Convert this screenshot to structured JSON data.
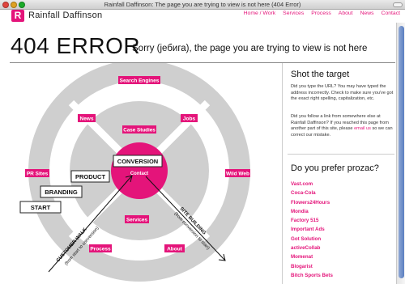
{
  "window": {
    "title": "Rainfall Daffinson: The page you are trying to view is not here (404 Error)"
  },
  "brand": {
    "logo_letter": "R",
    "name": "Rainfall Daffinson",
    "brand_color": "#e4147a"
  },
  "nav": [
    "Home / Work",
    "Services",
    "Process",
    "About",
    "News",
    "Contact"
  ],
  "error": {
    "title": "404 ERROR",
    "subtitle": "Sorry (јебига), the page you are trying to view is not here"
  },
  "diagram": {
    "ring_labels": {
      "search_engines": "Search Engines",
      "news": "News",
      "jobs": "Jobs",
      "pr_sites": "PR Sites",
      "wild_web": "Wild Web",
      "process": "Process",
      "about": "About"
    },
    "inner_labels": {
      "case_studies": "Case Studies",
      "services": "Services",
      "contact": "Contact"
    },
    "conversion": "CONVERSION",
    "steps": {
      "product": "PRODUCT",
      "branding": "BRANDING",
      "start": "START"
    },
    "arrows": {
      "customer_walk": "CUSTOMER WALK",
      "customer_walk_sub": "(from start to conversion)",
      "site_building": "SITE BUILDING",
      "site_building_sub": "(from conversion to start)"
    }
  },
  "sidebar": {
    "target_heading": "Shot the target",
    "target_p1": "Did you type the URL? You may have typed the address incorrectly. Check to make sure you've got the exact right spelling, capitalization, etc.",
    "target_p2_pre": "Did you follow a link from somewhere else at Rainfall Daffinson? If you reached this page from another part of this site, please",
    "target_p2_link": "email us",
    "target_p2_post": "so we can correct our mistake.",
    "prozac_heading": "Do you prefer prozac?",
    "prozac_links": [
      "Vast.com",
      "Coca-Cola",
      "Flowers24Hours",
      "Mondia",
      "Factory 515",
      "Important Ads",
      "Got Solution",
      "activeCollab",
      "Momenat",
      "Blogarist",
      "Bitch Sports Bets"
    ]
  }
}
